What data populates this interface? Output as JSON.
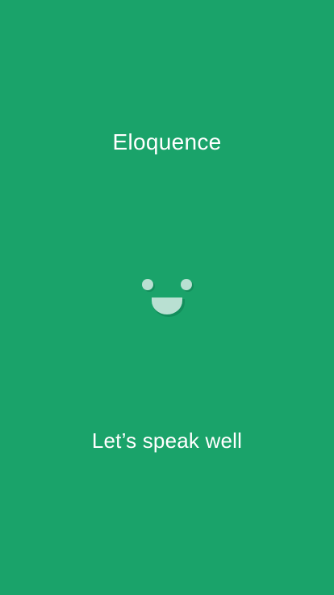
{
  "app": {
    "title": "Eloquence",
    "tagline": "Let’s speak well",
    "mascot_icon": "smiley-face-icon"
  },
  "colors": {
    "background": "#1aa36a",
    "text": "#ffffff",
    "face": "#b9e0d2",
    "face_shadow": "#0f7e51"
  }
}
